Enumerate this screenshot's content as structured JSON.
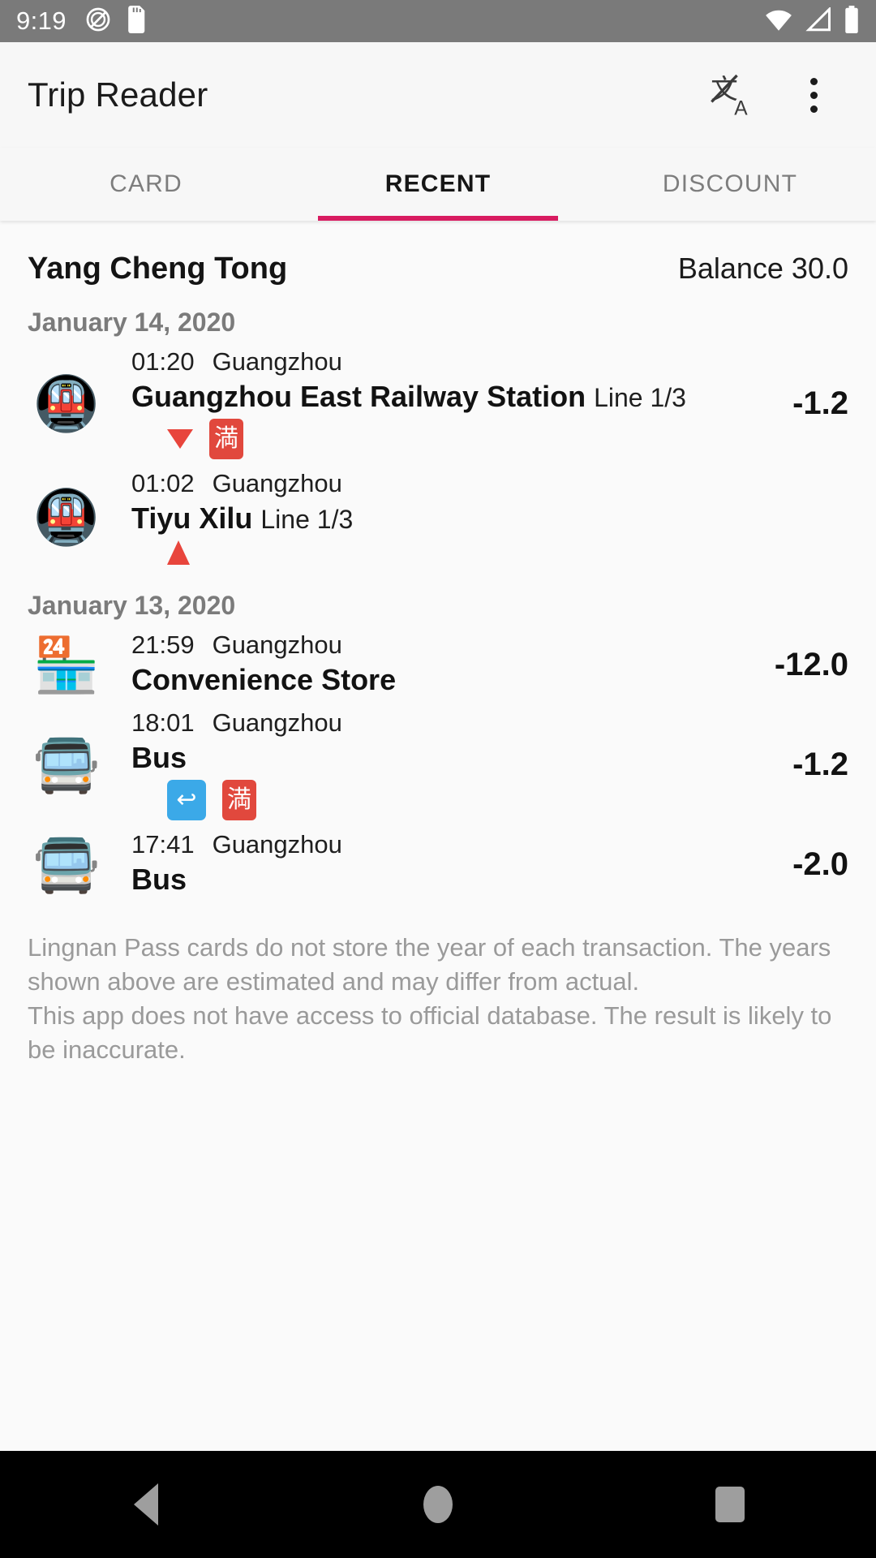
{
  "status_bar": {
    "clock": "9:19",
    "icons": [
      "no-sound-icon",
      "sd-card-icon",
      "wifi-icon",
      "cell-signal-icon",
      "battery-icon"
    ]
  },
  "app_bar": {
    "title": "Trip Reader",
    "translate_icon": "translate-icon",
    "overflow_icon": "overflow-menu-icon"
  },
  "tabs": [
    {
      "label": "CARD",
      "active": false
    },
    {
      "label": "RECENT",
      "active": true
    },
    {
      "label": "DISCOUNT",
      "active": false
    }
  ],
  "accent_color": "#D81B60",
  "card": {
    "name": "Yang Cheng Tong",
    "balance_label": "Balance 30.0"
  },
  "sections": [
    {
      "date": "January 14, 2020",
      "transactions": [
        {
          "icon": "metro-icon",
          "glyph": "🚇",
          "time": "01:20",
          "city": "Guangzhou",
          "title": "Guangzhou East Railway Station",
          "subtitle": "Line 1/3",
          "amount": "-1.2",
          "badges": [
            {
              "type": "triangle-down",
              "name": "exit-arrow-icon",
              "text": ""
            },
            {
              "type": "cjk-red",
              "name": "full-fare-badge",
              "text": "満"
            }
          ]
        },
        {
          "icon": "metro-icon",
          "glyph": "🚇",
          "time": "01:02",
          "city": "Guangzhou",
          "title": "Tiyu Xilu",
          "subtitle": "Line 1/3",
          "amount": "",
          "badges": [
            {
              "type": "triangle-up",
              "name": "entry-arrow-icon",
              "text": ""
            }
          ]
        }
      ]
    },
    {
      "date": "January 13, 2020",
      "transactions": [
        {
          "icon": "convenience-store-icon",
          "glyph": "🏪",
          "time": "21:59",
          "city": "Guangzhou",
          "title": "Convenience Store",
          "subtitle": "",
          "amount": "-12.0",
          "badges": []
        },
        {
          "icon": "bus-icon",
          "glyph": "🚍",
          "time": "18:01",
          "city": "Guangzhou",
          "title": "Bus",
          "subtitle": "",
          "amount": "-1.2",
          "badges": [
            {
              "type": "blue",
              "name": "transfer-badge",
              "text": "↩"
            },
            {
              "type": "cjk-red",
              "name": "full-fare-badge",
              "text": "満"
            }
          ]
        },
        {
          "icon": "bus-icon",
          "glyph": "🚍",
          "time": "17:41",
          "city": "Guangzhou",
          "title": "Bus",
          "subtitle": "",
          "amount": "-2.0",
          "badges": []
        }
      ]
    }
  ],
  "footer": {
    "line1": "Lingnan Pass cards do not store the year of each transaction. The years shown above are estimated and may differ from actual.",
    "line2": "This app does not have access to official database. The result is likely to be inaccurate."
  },
  "nav_bar": {
    "back": "back-button",
    "home": "home-button",
    "recents": "recents-button"
  }
}
